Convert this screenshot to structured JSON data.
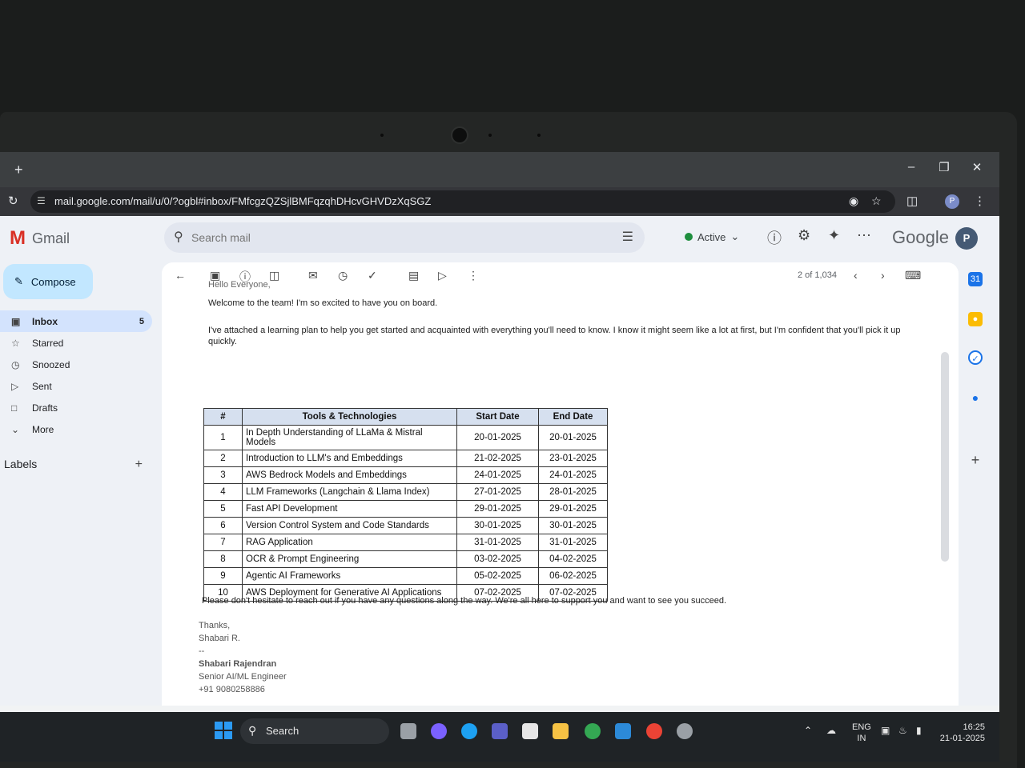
{
  "browser": {
    "url": "mail.google.com/mail/u/0/?ogbl#inbox/FMfcgzQZSjlBMFqzqhDHcvGHVDzXqSGZ",
    "profile_initial": "P"
  },
  "gmail": {
    "app_name": "Gmail",
    "search_placeholder": "Search mail",
    "status": "Active",
    "brand": "Google",
    "avatar_initial": "P",
    "compose_label": "Compose",
    "nav": [
      {
        "label": "Inbox",
        "count": "5",
        "icon": "inbox-icon"
      },
      {
        "label": "Starred",
        "count": "",
        "icon": "star-icon"
      },
      {
        "label": "Snoozed",
        "count": "",
        "icon": "clock-icon"
      },
      {
        "label": "Sent",
        "count": "",
        "icon": "send-icon"
      },
      {
        "label": "Drafts",
        "count": "",
        "icon": "draft-icon"
      },
      {
        "label": "More",
        "count": "",
        "icon": "chevron-down-icon"
      }
    ],
    "labels_heading": "Labels",
    "pager": "2 of 1,034"
  },
  "email": {
    "cut_greeting": "Hello Everyone,",
    "welcome": "Welcome to the team! I'm so excited to have you on board.",
    "intro": "I've attached a learning plan to help you get started and acquainted with everything you'll need to know. I know it might seem like a lot at first, but I'm confident that you'll pick it up quickly.",
    "table": {
      "headers": [
        "#",
        "Tools & Technologies",
        "Start Date",
        "End Date"
      ],
      "rows": [
        [
          "1",
          "In Depth Understanding of LLaMa & Mistral Models",
          "20-01-2025",
          "20-01-2025"
        ],
        [
          "2",
          "Introduction to LLM's and Embeddings",
          "21-02-2025",
          "23-01-2025"
        ],
        [
          "3",
          "AWS Bedrock Models and Embeddings",
          "24-01-2025",
          "24-01-2025"
        ],
        [
          "4",
          "LLM Frameworks (Langchain & Llama Index)",
          "27-01-2025",
          "28-01-2025"
        ],
        [
          "5",
          "Fast API Development",
          "29-01-2025",
          "29-01-2025"
        ],
        [
          "6",
          "Version Control System and Code Standards",
          "30-01-2025",
          "30-01-2025"
        ],
        [
          "7",
          "RAG Application",
          "31-01-2025",
          "31-01-2025"
        ],
        [
          "8",
          "OCR & Prompt Engineering",
          "03-02-2025",
          "04-02-2025"
        ],
        [
          "9",
          "Agentic AI Frameworks",
          "05-02-2025",
          "06-02-2025"
        ],
        [
          "10",
          "AWS Deployment for Generative AI Applications",
          "07-02-2025",
          "07-02-2025"
        ]
      ]
    },
    "closing": "Please don't hesitate to reach out if you have any questions along the way. We're all here to support you and want to see you succeed.",
    "thanks": "Thanks,",
    "short_name": "Shabari R.",
    "sig_dashes": "--",
    "sig_name": "Shabari Rajendran",
    "sig_title": "Senior AI/ML Engineer",
    "sig_phone": "+91 9080258886"
  },
  "taskbar": {
    "search_label": "Search",
    "lang_line1": "ENG",
    "lang_line2": "IN",
    "time": "16:25",
    "date": "21-01-2025"
  }
}
